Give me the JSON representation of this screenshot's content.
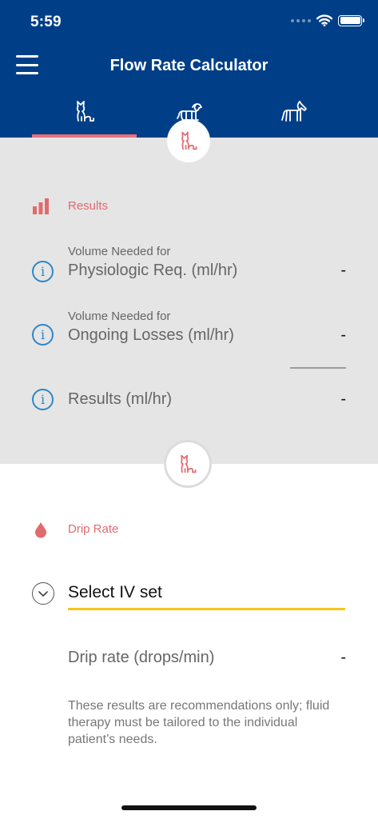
{
  "status_bar": {
    "time": "5:59"
  },
  "header": {
    "title": "Flow Rate Calculator"
  },
  "colors": {
    "brand_blue": "#003f87",
    "accent_red": "#e06b6f",
    "info_blue": "#2f86c8",
    "select_yellow": "#f5c619",
    "panel_gray": "#e5e5e5"
  },
  "tabs": [
    {
      "icon": "cat-icon",
      "active": true
    },
    {
      "icon": "dog-icon",
      "active": false
    },
    {
      "icon": "horse-icon",
      "active": false
    }
  ],
  "results": {
    "heading": "Results",
    "rows": [
      {
        "caption": "Volume Needed for",
        "label": "Physiologic Req. (ml/hr)",
        "value": "-"
      },
      {
        "caption": "Volume Needed for",
        "label": "Ongoing Losses (ml/hr)",
        "value": "-"
      },
      {
        "label": "Results (ml/hr)",
        "value": "-"
      }
    ]
  },
  "drip_rate": {
    "heading": "Drip Rate",
    "select_label": "Select IV set",
    "row_label": "Drip rate (drops/min)",
    "row_value": "-"
  },
  "disclaimer": "These results are recommendations only; fluid therapy must be tailored to the individual patient’s needs."
}
